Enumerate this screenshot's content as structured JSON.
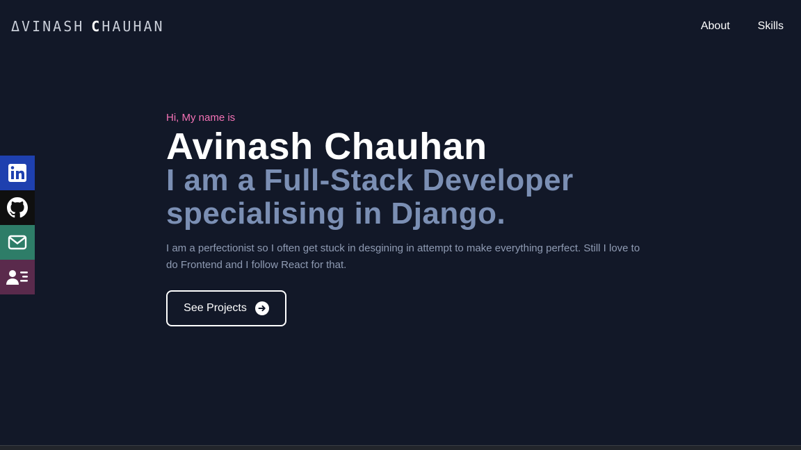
{
  "header": {
    "logo_first_initial": "A",
    "logo_first_rest": "VINASH",
    "logo_last_initial": "C",
    "logo_last_rest": "HAUHAN",
    "nav": [
      {
        "label": "About"
      },
      {
        "label": "Skills"
      }
    ]
  },
  "social": [
    {
      "icon": "linkedin-icon",
      "color": "#1e40af"
    },
    {
      "icon": "github-icon",
      "color": "#0f0f0f"
    },
    {
      "icon": "mail-icon",
      "color": "#2e7d68"
    },
    {
      "icon": "resume-icon",
      "color": "#5a2a4c"
    }
  ],
  "hero": {
    "intro": "Hi, My name is",
    "name": "Avinash Chauhan",
    "role": "I am a Full-Stack Developer specialising in Django.",
    "description": "I am a perfectionist so I often get stuck in desgining in attempt to make everything perfect. Still I love to do Frontend and I follow React for that.",
    "cta_label": "See Projects"
  },
  "colors": {
    "background": "#121828",
    "accent_pink": "#f472b6",
    "role_text": "#7b8fb4"
  }
}
